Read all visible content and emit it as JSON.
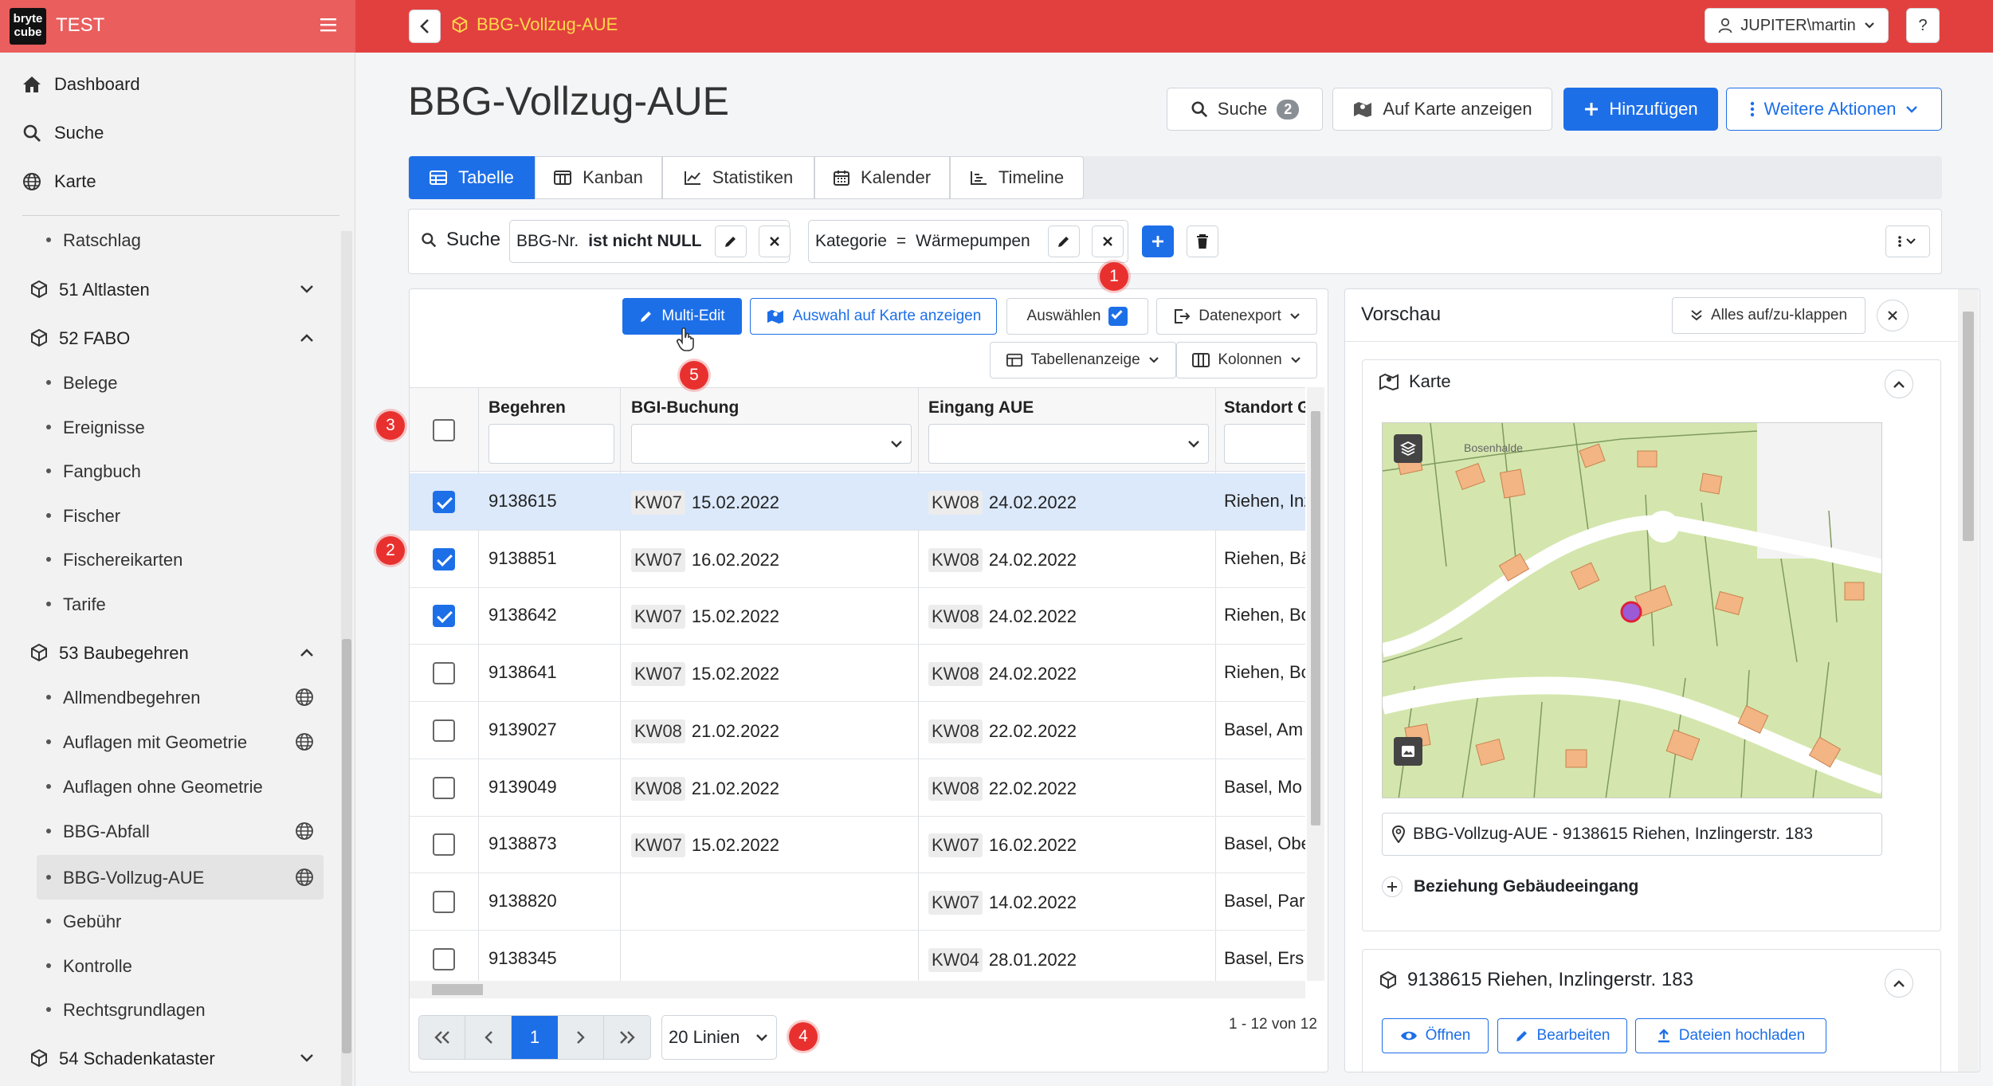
{
  "app": {
    "title": "TEST",
    "logo_text": "bryte cube"
  },
  "topbar": {
    "title": "BBG-Vollzug-AUE",
    "user": "JUPITER\\martin",
    "help": "?"
  },
  "sidebar": {
    "top": [
      {
        "label": "Dashboard"
      },
      {
        "label": "Suche"
      },
      {
        "label": "Karte"
      }
    ],
    "items": [
      {
        "label": "Ratschlag"
      },
      {
        "label": "51 Altlasten"
      },
      {
        "label": "52 FABO"
      },
      {
        "label": "Belege"
      },
      {
        "label": "Ereignisse"
      },
      {
        "label": "Fangbuch"
      },
      {
        "label": "Fischer"
      },
      {
        "label": "Fischereikarten"
      },
      {
        "label": "Tarife"
      },
      {
        "label": "53 Baubegehren"
      },
      {
        "label": "Allmendbegehren"
      },
      {
        "label": "Auflagen mit Geometrie"
      },
      {
        "label": "Auflagen ohne Geometrie"
      },
      {
        "label": "BBG-Abfall"
      },
      {
        "label": "BBG-Vollzug-AUE"
      },
      {
        "label": "Gebühr"
      },
      {
        "label": "Kontrolle"
      },
      {
        "label": "Rechtsgrundlagen"
      },
      {
        "label": "54 Schadenkataster"
      }
    ]
  },
  "page": {
    "title": "BBG-Vollzug-AUE",
    "actions": {
      "search": "Suche",
      "search_count": "2",
      "map": "Auf Karte anzeigen",
      "add": "Hinzufügen",
      "more": "Weitere Aktionen"
    }
  },
  "tabs": [
    {
      "label": "Tabelle"
    },
    {
      "label": "Kanban"
    },
    {
      "label": "Statistiken"
    },
    {
      "label": "Kalender"
    },
    {
      "label": "Timeline"
    }
  ],
  "filter": {
    "label": "Suche",
    "chip1_field": "BBG-Nr.",
    "chip1_op": "ist nicht NULL",
    "chip2_field": "Kategorie",
    "chip2_op": "=",
    "chip2_value": "Wärmepumpen"
  },
  "toolbar": {
    "multi_edit": "Multi-Edit",
    "selection_map": "Auswahl auf Karte anzeigen",
    "select": "Auswählen",
    "export": "Datenexport",
    "table_view": "Tabellenanzeige",
    "columns": "Kolonnen"
  },
  "table": {
    "headers": [
      "Begehren",
      "BGI-Buchung",
      "Eingang AUE",
      "Standort G"
    ],
    "rows": [
      {
        "checked": true,
        "id": "9138615",
        "bgi_kw": "KW07",
        "bgi_date": "15.02.2022",
        "aue_kw": "KW08",
        "aue_date": "24.02.2022",
        "standort": "Riehen, Inz"
      },
      {
        "checked": true,
        "id": "9138851",
        "bgi_kw": "KW07",
        "bgi_date": "16.02.2022",
        "aue_kw": "KW08",
        "aue_date": "24.02.2022",
        "standort": "Riehen, Bä"
      },
      {
        "checked": true,
        "id": "9138642",
        "bgi_kw": "KW07",
        "bgi_date": "15.02.2022",
        "aue_kw": "KW08",
        "aue_date": "24.02.2022",
        "standort": "Riehen, Bo"
      },
      {
        "checked": false,
        "id": "9138641",
        "bgi_kw": "KW07",
        "bgi_date": "15.02.2022",
        "aue_kw": "KW08",
        "aue_date": "24.02.2022",
        "standort": "Riehen, Bo"
      },
      {
        "checked": false,
        "id": "9139027",
        "bgi_kw": "KW08",
        "bgi_date": "21.02.2022",
        "aue_kw": "KW08",
        "aue_date": "22.02.2022",
        "standort": "Basel, Am"
      },
      {
        "checked": false,
        "id": "9139049",
        "bgi_kw": "KW08",
        "bgi_date": "21.02.2022",
        "aue_kw": "KW08",
        "aue_date": "22.02.2022",
        "standort": "Basel, Mo"
      },
      {
        "checked": false,
        "id": "9138873",
        "bgi_kw": "KW07",
        "bgi_date": "15.02.2022",
        "aue_kw": "KW07",
        "aue_date": "16.02.2022",
        "standort": "Basel, Obe"
      },
      {
        "checked": false,
        "id": "9138820",
        "bgi_kw": "",
        "bgi_date": "",
        "aue_kw": "KW07",
        "aue_date": "14.02.2022",
        "standort": "Basel, Par"
      },
      {
        "checked": false,
        "id": "9138345",
        "bgi_kw": "",
        "bgi_date": "",
        "aue_kw": "KW04",
        "aue_date": "28.01.2022",
        "standort": "Basel, Ers"
      }
    ]
  },
  "pagination": {
    "page": "1",
    "per_page": "20 Linien",
    "range": "1 - 12 von 12"
  },
  "annotations": [
    "1",
    "2",
    "3",
    "4",
    "5"
  ],
  "preview": {
    "title": "Vorschau",
    "expand": "Alles auf/zu-klappen",
    "map_section": "Karte",
    "map_label": "Bosenhalde",
    "location": "BBG-Vollzug-AUE - 9138615 Riehen, Inzlingerstr. 183",
    "relation": "Beziehung Gebäudeeingang",
    "record_title": "9138615 Riehen, Inzlingerstr. 183",
    "open": "Öffnen",
    "edit": "Bearbeiten",
    "upload": "Dateien hochladen"
  },
  "colors": {
    "primary": "#1d6fe8",
    "header_red": "#e2403f",
    "sidebar_head": "#ea5e5e",
    "title_yellow": "#ffd84a",
    "badge_red": "#e8312f"
  }
}
